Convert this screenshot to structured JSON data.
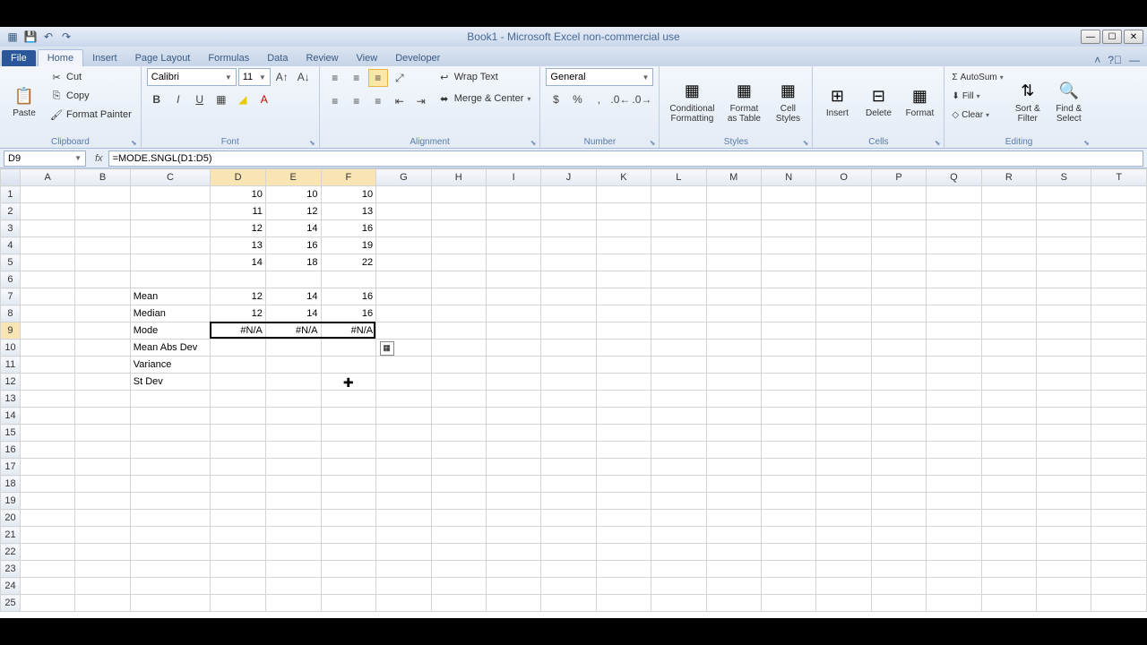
{
  "title": "Book1  -  Microsoft Excel non-commercial use",
  "tabs": {
    "file": "File",
    "items": [
      "Home",
      "Insert",
      "Page Layout",
      "Formulas",
      "Data",
      "Review",
      "View",
      "Developer"
    ],
    "active": "Home"
  },
  "clipboard": {
    "paste": "Paste",
    "cut": "Cut",
    "copy": "Copy",
    "format_painter": "Format Painter",
    "group": "Clipboard"
  },
  "font": {
    "name": "Calibri",
    "size": "11",
    "group": "Font"
  },
  "alignment": {
    "wrap": "Wrap Text",
    "merge": "Merge & Center",
    "group": "Alignment"
  },
  "number": {
    "format": "General",
    "group": "Number"
  },
  "styles": {
    "cond": "Conditional Formatting",
    "table": "Format as Table",
    "cell": "Cell Styles",
    "group": "Styles"
  },
  "cells": {
    "insert": "Insert",
    "delete": "Delete",
    "format": "Format",
    "group": "Cells"
  },
  "editing": {
    "autosum": "AutoSum",
    "fill": "Fill",
    "clear": "Clear",
    "sort": "Sort & Filter",
    "find": "Find & Select",
    "group": "Editing"
  },
  "name_box": "D9",
  "formula": "=MODE.SNGL(D1:D5)",
  "columns": [
    "A",
    "B",
    "C",
    "D",
    "E",
    "F",
    "G",
    "H",
    "I",
    "J",
    "K",
    "L",
    "M",
    "N",
    "O",
    "P",
    "Q",
    "R",
    "S",
    "T"
  ],
  "labels": {
    "mean": "Mean",
    "median": "Median",
    "mode": "Mode",
    "mad": "Mean Abs Dev",
    "variance": "Variance",
    "stdev": "St Dev"
  },
  "cells_data": {
    "D1": "10",
    "E1": "10",
    "F1": "10",
    "D2": "11",
    "E2": "12",
    "F2": "13",
    "D3": "12",
    "E3": "14",
    "F3": "16",
    "D4": "13",
    "E4": "16",
    "F4": "19",
    "D5": "14",
    "E5": "18",
    "F5": "22",
    "D7": "12",
    "E7": "14",
    "F7": "16",
    "D8": "12",
    "E8": "14",
    "F8": "16",
    "D9": "#N/A",
    "E9": "#N/A",
    "F9": "#N/A"
  }
}
